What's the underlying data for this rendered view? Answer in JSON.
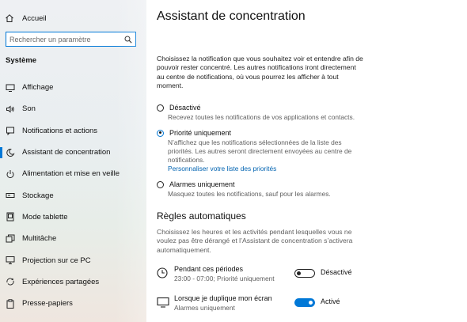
{
  "sidebar": {
    "home_label": "Accueil",
    "search_placeholder": "Rechercher un paramètre",
    "section_label": "Système",
    "items": [
      {
        "label": "Affichage",
        "icon": "display-icon"
      },
      {
        "label": "Son",
        "icon": "speaker-icon"
      },
      {
        "label": "Notifications et actions",
        "icon": "notifications-icon"
      },
      {
        "label": "Assistant de concentration",
        "icon": "moon-icon",
        "active": true
      },
      {
        "label": "Alimentation et mise en veille",
        "icon": "power-icon"
      },
      {
        "label": "Stockage",
        "icon": "storage-icon"
      },
      {
        "label": "Mode tablette",
        "icon": "tablet-icon"
      },
      {
        "label": "Multitâche",
        "icon": "multitask-icon"
      },
      {
        "label": "Projection sur ce PC",
        "icon": "projection-icon"
      },
      {
        "label": "Expériences partagées",
        "icon": "shared-experiences-icon"
      },
      {
        "label": "Presse-papiers",
        "icon": "clipboard-icon"
      }
    ]
  },
  "main": {
    "title": "Assistant de concentration",
    "intro": "Choisissez la notification que vous souhaitez voir et entendre afin de pouvoir rester concentré. Les autres notifications iront directement au centre de notifications, où vous pourrez les afficher à tout moment.",
    "options": [
      {
        "label": "Désactivé",
        "description": "Recevez toutes les notifications de vos applications et contacts.",
        "checked": false
      },
      {
        "label": "Priorité uniquement",
        "description": "N’affichez que les notifications sélectionnées de la liste des priorités. Les autres seront directement envoyées au centre de notifications.",
        "link": "Personnaliser votre liste des priorités",
        "checked": true
      },
      {
        "label": "Alarmes uniquement",
        "description": "Masquez toutes les notifications, sauf pour les alarmes.",
        "checked": false
      }
    ],
    "rules_heading": "Règles automatiques",
    "rules_intro": "Choisissez les heures et les activités pendant lesquelles vous ne voulez pas être dérangé et l’Assistant de concentration s’activera automatiquement.",
    "rules": [
      {
        "title": "Pendant ces périodes",
        "subtitle": "23:00 - 07:00; Priorité uniquement",
        "state_label": "Désactivé",
        "on": false,
        "icon": "clock-icon"
      },
      {
        "title": "Lorsque je duplique mon écran",
        "subtitle": "Alarmes uniquement",
        "state_label": "Activé",
        "on": true,
        "icon": "monitor-icon"
      }
    ]
  },
  "colors": {
    "accent": "#0078d7",
    "link": "#0063b1",
    "secondary_text": "#5f5f5f"
  }
}
